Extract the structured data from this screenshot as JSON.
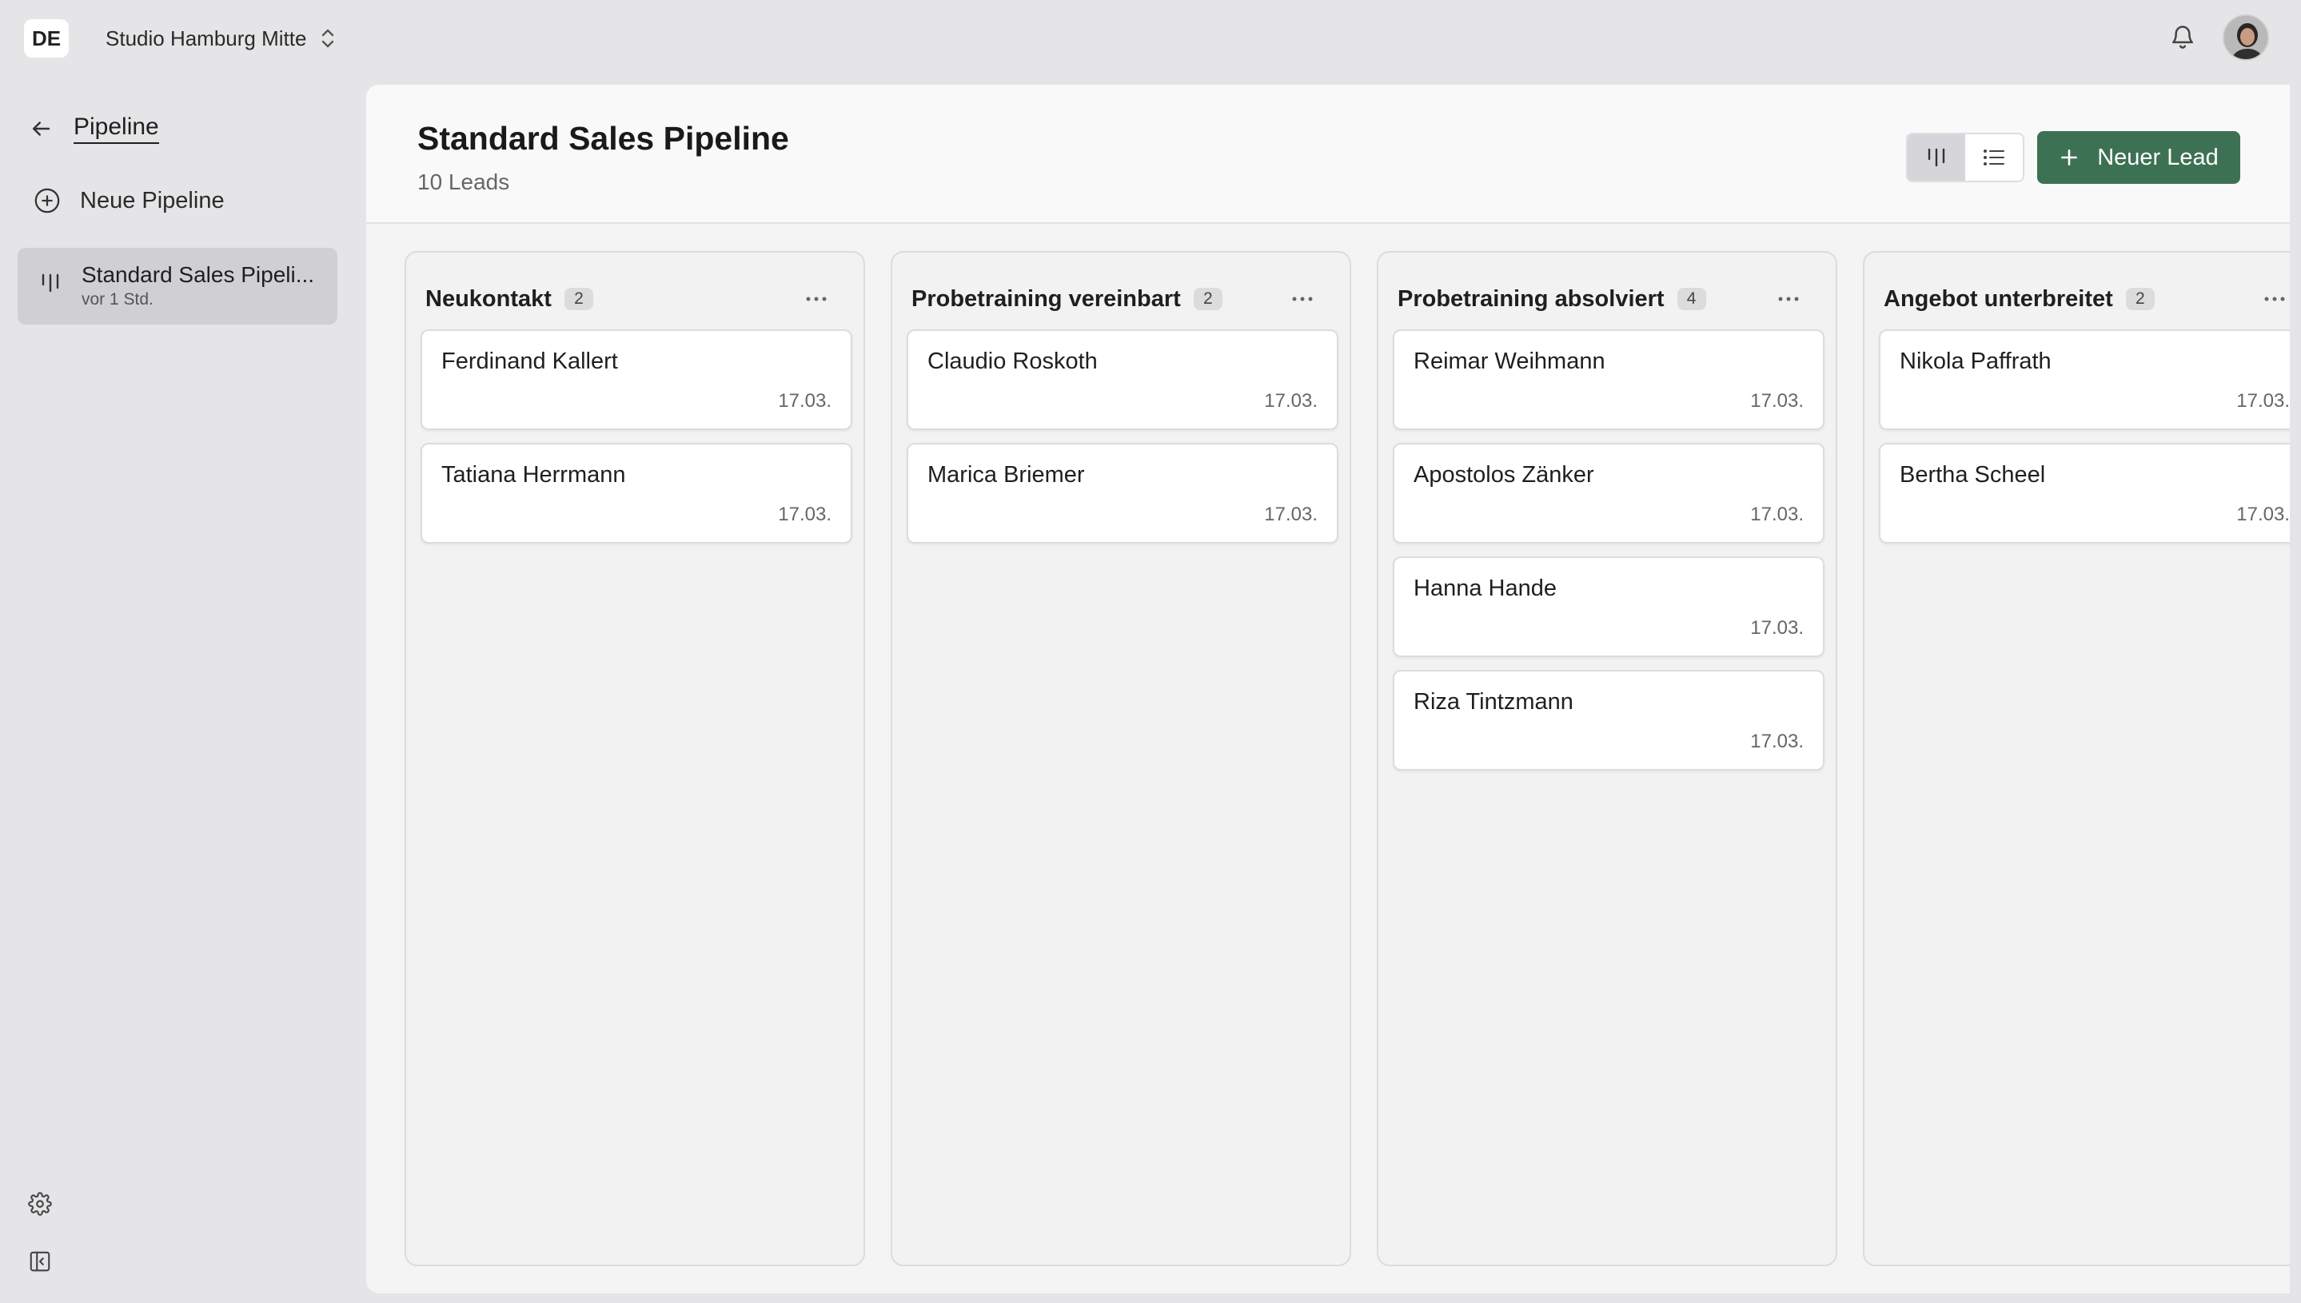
{
  "topbar": {
    "org_code": "DE",
    "studio_name": "Studio Hamburg Mitte"
  },
  "sidebar": {
    "back_label": "Pipeline",
    "new_pipeline_label": "Neue Pipeline",
    "pipeline_item": {
      "title": "Standard Sales Pipeli...",
      "subtitle": "vor 1 Std."
    }
  },
  "main": {
    "title": "Standard Sales Pipeline",
    "lead_count": "10 Leads",
    "new_lead_label": "Neuer Lead",
    "view_mode": "board"
  },
  "colors": {
    "accent": "#3d7153",
    "background": "#e5e5e7",
    "active_item": "#d0d0d4"
  },
  "columns": [
    {
      "title": "Neukontakt",
      "count": "2",
      "cards": [
        {
          "name": "Ferdinand Kallert",
          "date": "17.03."
        },
        {
          "name": "Tatiana Herrmann",
          "date": "17.03."
        }
      ]
    },
    {
      "title": "Probetraining vereinbart",
      "count": "2",
      "cards": [
        {
          "name": "Claudio Roskoth",
          "date": "17.03."
        },
        {
          "name": "Marica Briemer",
          "date": "17.03."
        }
      ]
    },
    {
      "title": "Probetraining absolviert",
      "count": "4",
      "cards": [
        {
          "name": "Reimar Weihmann",
          "date": "17.03."
        },
        {
          "name": "Apostolos Zänker",
          "date": "17.03."
        },
        {
          "name": "Hanna Hande",
          "date": "17.03."
        },
        {
          "name": "Riza Tintzmann",
          "date": "17.03."
        }
      ]
    },
    {
      "title": "Angebot unterbreitet",
      "count": "2",
      "cards": [
        {
          "name": "Nikola Paffrath",
          "date": "17.03."
        },
        {
          "name": "Bertha Scheel",
          "date": "17.03."
        }
      ]
    }
  ]
}
